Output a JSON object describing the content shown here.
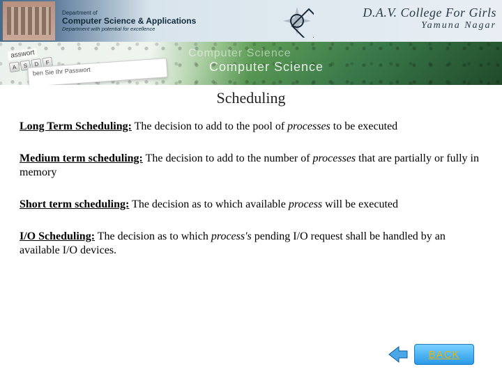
{
  "header": {
    "dept_top": "Department of",
    "dept_main": "Computer Science & Applications",
    "dept_sub": "Department with potential for excellence",
    "college_main": "D.A.V. College For Girls",
    "college_sub": "Yamuna Nagar"
  },
  "subbanner": {
    "key_label": "asswort",
    "card_text": "ben Sie Ihr Passwort",
    "cs1": "Computer Science",
    "cs2": "Computer Science"
  },
  "title": "Scheduling",
  "entries": [
    {
      "term": "Long Term Scheduling:",
      "pre": " The decision to add to the pool of ",
      "ital": "processes",
      "post": " to be executed"
    },
    {
      "term": "Medium term scheduling:",
      "pre": " The decision to add to the number of ",
      "ital": "processes",
      "post": " that are partially or fully in memory"
    },
    {
      "term": "Short term scheduling:",
      "pre": " The decision as to which available ",
      "ital": "process",
      "post": " will be executed"
    },
    {
      "term": "I/O Scheduling:",
      "pre": " The decision as to which ",
      "ital": "process's",
      "post": " pending I/O request shall be handled by an available I/O devices."
    }
  ],
  "back_label": "BACK"
}
